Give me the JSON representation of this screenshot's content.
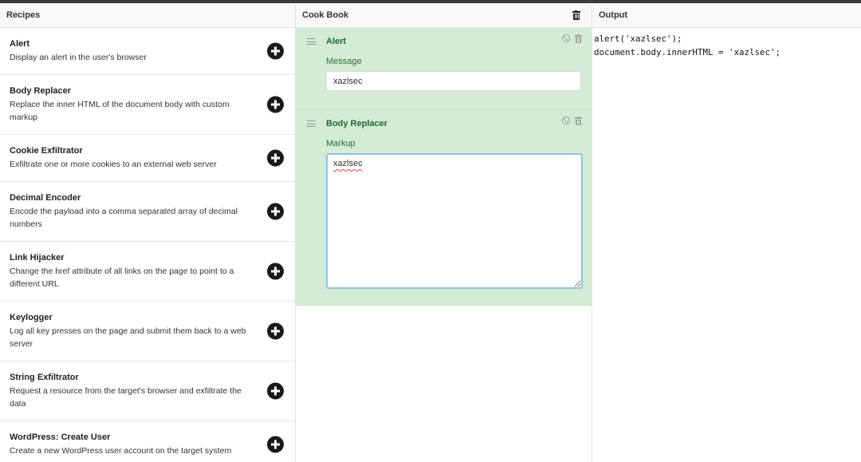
{
  "recipes": {
    "header": "Recipes",
    "items": [
      {
        "name": "Alert",
        "desc": "Display an alert in the user's browser"
      },
      {
        "name": "Body Replacer",
        "desc": "Replace the inner HTML of the document body with custom markup"
      },
      {
        "name": "Cookie Exfiltrator",
        "desc": "Exfiltrate one or more cookies to an external web server"
      },
      {
        "name": "Decimal Encoder",
        "desc": "Encode the payload into a comma separated array of decimal numbers"
      },
      {
        "name": "Link Hijacker",
        "desc": "Change the href attribute of all links on the page to point to a different URL"
      },
      {
        "name": "Keylogger",
        "desc": "Log all key presses on the page and submit them back to a web server"
      },
      {
        "name": "String Exfiltrator",
        "desc": "Request a resource from the target's browser and exfiltrate the data"
      },
      {
        "name": "WordPress: Create User",
        "desc": "Create a new WordPress user account on the target system"
      }
    ]
  },
  "cookbook": {
    "header": "Cook Book",
    "steps": [
      {
        "title": "Alert",
        "field_label": "Message",
        "value": "xazlsec"
      },
      {
        "title": "Body Replacer",
        "field_label": "Markup",
        "value": "xazlsec"
      }
    ]
  },
  "output": {
    "header": "Output",
    "lines": [
      "alert('xazlsec');",
      "document.body.innerHTML = 'xazlsec';"
    ]
  },
  "icons": {
    "add": "plus-circle-icon",
    "trash": "trash-icon",
    "disable": "disable-icon",
    "drag": "drag-handle-icon"
  },
  "colors": {
    "step_bg": "#d4ecd6",
    "step_title": "#1f6b2c",
    "textarea_focus": "#8ec3e8"
  }
}
